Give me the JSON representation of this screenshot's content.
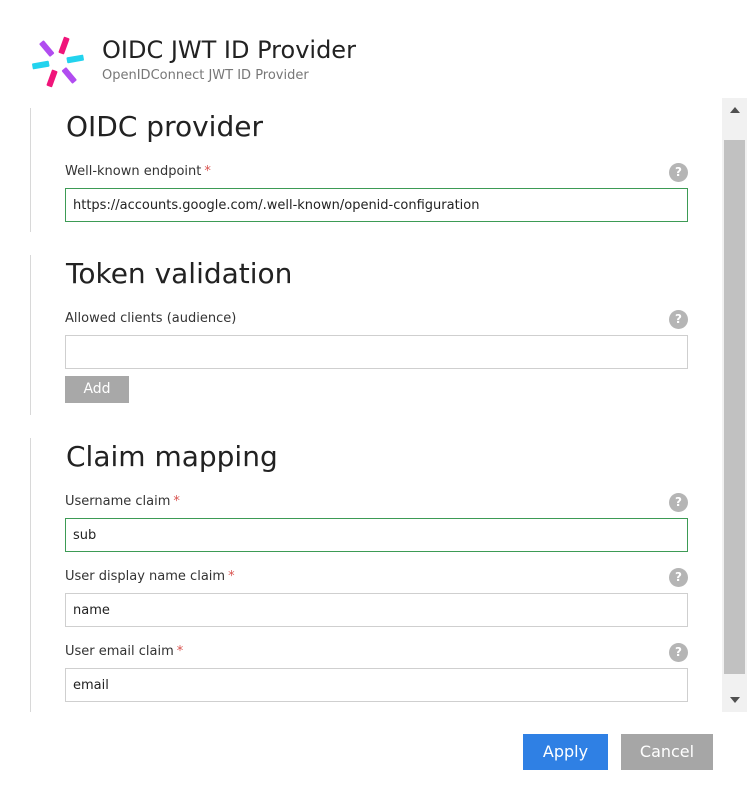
{
  "header": {
    "logo_icon": "jwt-logo-icon",
    "title": "OIDC JWT ID Provider",
    "subtitle": "OpenIDConnect JWT ID Provider"
  },
  "sections": {
    "oidc": {
      "title": "OIDC provider",
      "well_known": {
        "label": "Well-known endpoint",
        "required_mark": "*",
        "value": "https://accounts.google.com/.well-known/openid-configuration",
        "help": "?"
      }
    },
    "token": {
      "title": "Token validation",
      "allowed_clients": {
        "label": "Allowed clients (audience)",
        "value": "",
        "help": "?"
      },
      "add_label": "Add"
    },
    "claims": {
      "title": "Claim mapping",
      "username": {
        "label": "Username claim",
        "required_mark": "*",
        "value": "sub",
        "help": "?"
      },
      "display_name": {
        "label": "User display name claim",
        "required_mark": "*",
        "value": "name",
        "help": "?"
      },
      "email": {
        "label": "User email claim",
        "required_mark": "*",
        "value": "email",
        "help": "?"
      }
    }
  },
  "footer": {
    "apply_label": "Apply",
    "cancel_label": "Cancel"
  },
  "colors": {
    "primary": "#2f80e4",
    "valid_border": "#3d9b55",
    "required": "#d9534f",
    "logo_pink": "#f0157a",
    "logo_cyan": "#22d3ee",
    "logo_purple": "#b14cf0"
  }
}
